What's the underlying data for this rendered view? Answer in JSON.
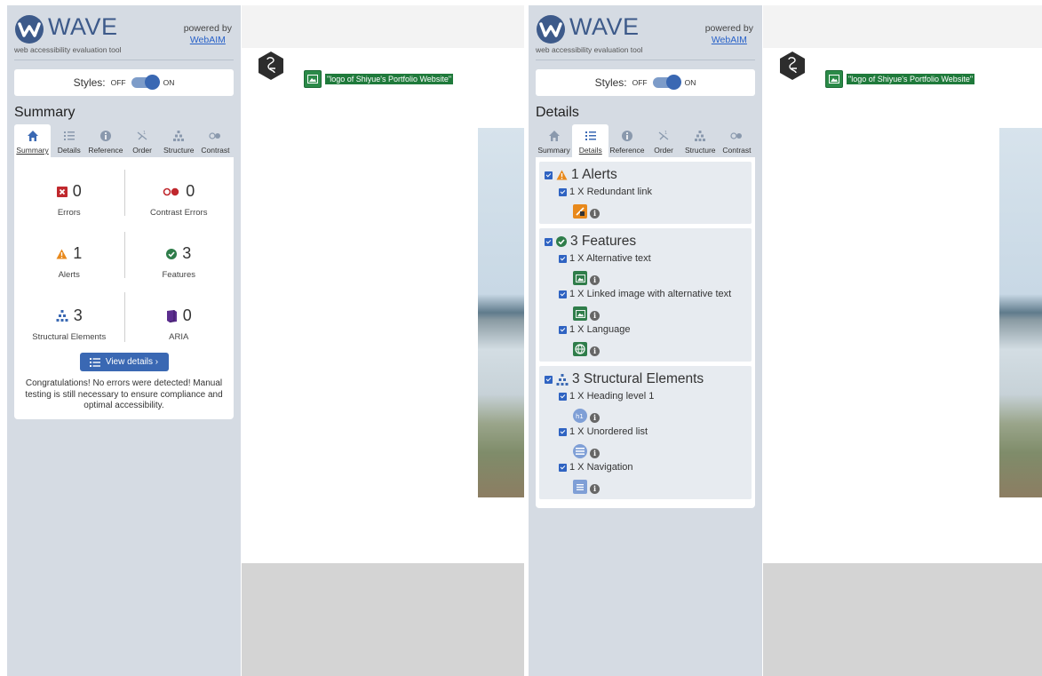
{
  "brand": {
    "name": "WAVE",
    "tagline": "web accessibility evaluation tool",
    "powered_by": "powered by",
    "webaim": "WebAIM"
  },
  "styles": {
    "label": "Styles:",
    "off": "OFF",
    "on": "ON"
  },
  "tabs": [
    {
      "label": "Summary",
      "icon": "home-icon"
    },
    {
      "label": "Details",
      "icon": "list-icon"
    },
    {
      "label": "Reference",
      "icon": "info-icon"
    },
    {
      "label": "Order",
      "icon": "order-icon"
    },
    {
      "label": "Structure",
      "icon": "structure-icon"
    },
    {
      "label": "Contrast",
      "icon": "contrast-icon"
    }
  ],
  "summary": {
    "title": "Summary",
    "errors": {
      "count": "0",
      "label": "Errors"
    },
    "contrast_errors": {
      "count": "0",
      "label": "Contrast Errors"
    },
    "alerts": {
      "count": "1",
      "label": "Alerts"
    },
    "features": {
      "count": "3",
      "label": "Features"
    },
    "structural": {
      "count": "3",
      "label": "Structural Elements"
    },
    "aria": {
      "count": "0",
      "label": "ARIA"
    },
    "view_details": "View details ›",
    "congrats": "Congratulations! No errors were detected! Manual testing is still necessary to ensure compliance and optimal accessibility."
  },
  "details": {
    "title": "Details",
    "alerts": {
      "heading": "1 Alerts",
      "items": [
        {
          "label": "1 X Redundant link"
        }
      ]
    },
    "features": {
      "heading": "3 Features",
      "items": [
        {
          "label": "1 X Alternative text"
        },
        {
          "label": "1 X Linked image with alternative text"
        },
        {
          "label": "1 X Language"
        }
      ]
    },
    "structure": {
      "heading": "3 Structural Elements",
      "items": [
        {
          "label": "1 X Heading level 1"
        },
        {
          "label": "1 X Unordered list"
        },
        {
          "label": "1 X Navigation"
        }
      ]
    }
  },
  "preview": {
    "alt_text": "\"logo of Shiyue's Portfolio Website\""
  },
  "colors": {
    "sidebar": "#d5dbe3",
    "accent": "#3a68b3",
    "error": "#c0282d",
    "alert": "#e8891c",
    "feature": "#2f7d4a",
    "structure": "#3a68b3",
    "aria": "#5b2d8e"
  }
}
